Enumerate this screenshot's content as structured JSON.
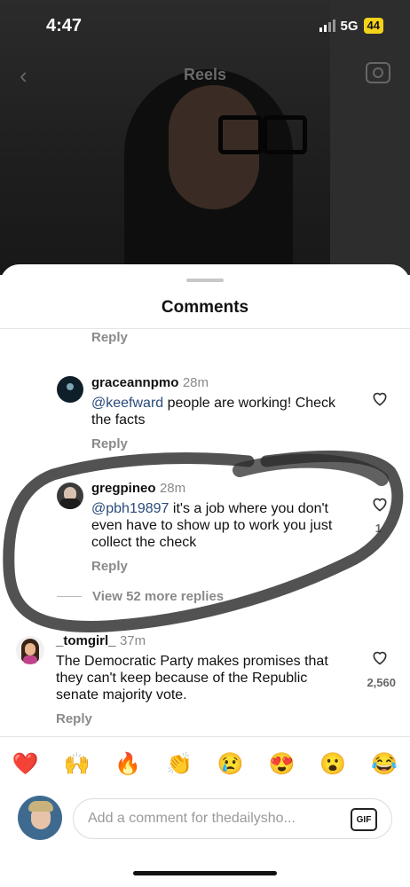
{
  "status_bar": {
    "time": "4:47",
    "network": "5G",
    "battery": "44"
  },
  "header": {
    "title": "Reels"
  },
  "sheet": {
    "title": "Comments"
  },
  "reply_label": "Reply",
  "comments": [
    {
      "username": "graceannpmo",
      "time": "28m",
      "mention": "@keefward",
      "text": " people are working! Check the facts"
    },
    {
      "username": "gregpineo",
      "time": "28m",
      "mention": "@pbh19897",
      "text": " it's a job where you don't even have to show up to work you just collect the check",
      "likes": "1"
    },
    {
      "username": "_tomgirl_",
      "time": "37m",
      "mention": "",
      "text": "The Democratic Party makes promises that they can't keep because of the Republic senate majority vote.",
      "likes": "2,560"
    }
  ],
  "view_more_replies": "View 52 more replies",
  "emojis": [
    "❤️",
    "🙌",
    "🔥",
    "👏",
    "😢",
    "😍",
    "😮",
    "😂"
  ],
  "comment_input": {
    "placeholder": "Add a comment for thedailysho...",
    "gif_label": "GIF"
  }
}
